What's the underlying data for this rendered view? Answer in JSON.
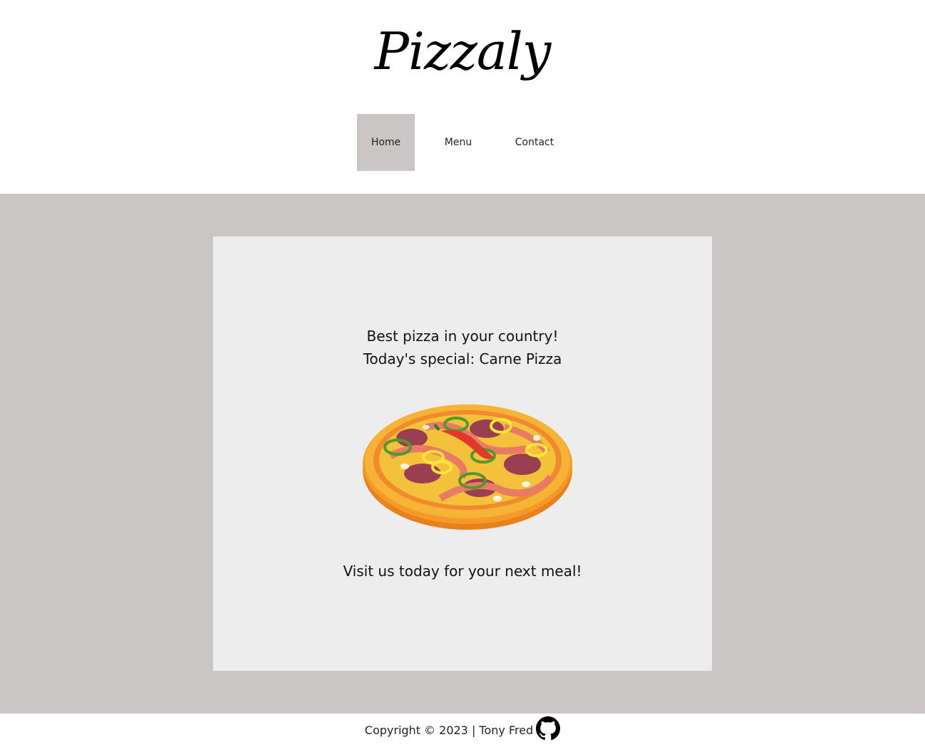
{
  "brand": {
    "title": "Pizzaly"
  },
  "nav": {
    "items": [
      {
        "label": "Home",
        "active": true
      },
      {
        "label": "Menu",
        "active": false
      },
      {
        "label": "Contact",
        "active": false
      }
    ]
  },
  "hero": {
    "tagline": "Best pizza in your country!",
    "special": "Today's special: Carne Pizza",
    "image_icon": "pizza-illustration",
    "cta": "Visit us today for your next meal!"
  },
  "footer": {
    "copyright": "Copyright © 2023 | Tony Fred",
    "link_icon": "github-icon"
  },
  "colors": {
    "page_bg": "#cac6c5",
    "card_bg": "#ededed",
    "nav_active_bg": "#cac6c5",
    "text": "#111111"
  }
}
